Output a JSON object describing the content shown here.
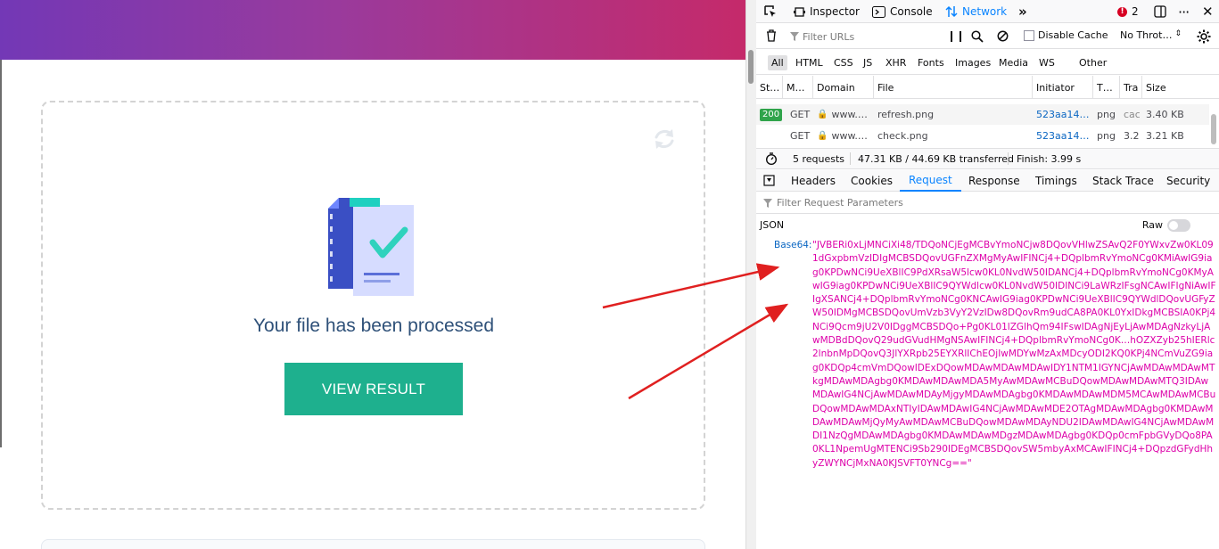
{
  "page": {
    "processed_text": "Your file has been processed",
    "view_result_label": "VIEW RESULT"
  },
  "devtools": {
    "toolbar": {
      "inspector": "Inspector",
      "console": "Console",
      "network": "Network",
      "error_count": "2"
    },
    "filter": {
      "placeholder": "Filter URLs",
      "disable_cache": "Disable Cache",
      "throttle": "No Throt…"
    },
    "types": [
      "All",
      "HTML",
      "CSS",
      "JS",
      "XHR",
      "Fonts",
      "Images",
      "Media",
      "WS",
      "Other"
    ],
    "columns": [
      "St…",
      "M…",
      "Domain",
      "File",
      "Initiator",
      "T…",
      "Tra",
      "Size"
    ],
    "rows": [
      {
        "status": "200",
        "method": "GET",
        "domain": "www.…",
        "file": "refresh.png",
        "initiator": "523aa14…",
        "type": "png",
        "transferred": "cac",
        "size": "3.40 KB"
      },
      {
        "status": "",
        "method": "GET",
        "domain": "www.…",
        "file": "check.png",
        "initiator": "523aa14…",
        "type": "png",
        "transferred": "3.2",
        "size": "3.21 KB"
      }
    ],
    "summary": {
      "requests": "5 requests",
      "transferred": "47.31 KB / 44.69 KB transferred",
      "finish": "Finish: 3.99 s"
    },
    "tabs": [
      "Headers",
      "Cookies",
      "Request",
      "Response",
      "Timings",
      "Stack Trace",
      "Security"
    ],
    "active_tab": "Request",
    "param_filter_placeholder": "Filter Request Parameters",
    "json_label": "JSON",
    "raw_label": "Raw",
    "base64_label": "Base64:",
    "base64_value": "\"JVBERi0xLjMNCiXi48/TDQoNCjEgMCBvYmoNCjw8DQovVHlwZSAvQ2F0YWxvZw0KL091dGxpbmVzIDIgMCBSDQovUGFnZXMgMyAwIFINCj4+DQplbmRvYmoNCg0KMiAwIG9iag0KPDwNCi9UeXBlIC9PdXRsaW5lcw0KL0NvdW50IDANCj4+DQplbmRvYmoNCg0KMyAwIG9iag0KPDwNCi9UeXBlIC9QYWdlcw0KL0NvdW50IDINCi9LaWRzIFsgNCAwIFIgNiAwIFIgXSANCj4+DQplbmRvYmoNCg0KNCAwIG9iag0KPDwNCi9UeXBlIC9QYWdlDQovUGFyZW50IDMgMCBSDQovUmVzb3VyY2VzIDw8DQovRm9udCA8PA0KL0YxIDkgMCBSIA0KPj4NCi9Qcm9jU2V0IDggMCBSDQo+Pg0KL01lZGlhQm94IFswIDAgNjEyLjAwMDAgNzkyLjAwMDBdDQovQ29udGVudHMgNSAwIFINCj4+DQplbmRvYmoNCg0K…hOZXZyb25hIERlc2lnbnMpDQovQ3JlYXRpb25EYXRlIChEOjIwMDYwMzAxMDcyODI2KQ0KPj4NCmVuZG9iag0KDQp4cmVmDQowIDExDQowMDAwMDAwMDAwIDY1NTM1IGYNCjAwMDAwMDAwMTkgMDAwMDAgbg0KMDAwMDAwMDA5MyAwMDAwMCBuDQowMDAwMDAwMTQ3IDAwMDAwIG4NCjAwMDAwMDAyMjgyMDAwMDAgbg0KMDAwMDAwMDM5MCAwMDAwMCBuDQowMDAwMDAxNTIyIDAwMDAwIG4NCjAwMDAwMDE2OTAgMDAwMDAgbg0KMDAwMDAwMDAwMjQyMyAwMDAwMCBuDQowMDAwMDAyNDU2IDAwMDAwIG4NCjAwMDAwMDI1NzQgMDAwMDAgbg0KMDAwMDAwMDgzMDAwMDAgbg0KDQp0cmFpbGVyDQo8PA0KL1NpemUgMTENCi9Sb290IDEgMCBSDQovSW5mbyAxMCAwIFINCj4+DQpzdGFydHhyZWYNCjMxNA0KJSVFT0YNCg==\""
  },
  "icons": [
    "refresh-icon",
    "document-check-icon",
    "pick-element-icon",
    "inspector-icon",
    "console-icon",
    "network-icon",
    "more-tools-icon",
    "error-icon",
    "dock-icon",
    "menu-icon",
    "close-icon",
    "trash-icon",
    "filter-icon",
    "pause-icon",
    "search-icon",
    "block-icon",
    "gear-icon",
    "lock-icon",
    "timer-icon",
    "sidebar-toggle-icon"
  ],
  "colors": {
    "accent_button": "#1eb08e",
    "banner_start": "#7338b6",
    "banner_end": "#c52a6a",
    "devtools_active": "#0a84ff",
    "base64_text": "#dd00a9",
    "annotation_arrow": "#e02020"
  }
}
